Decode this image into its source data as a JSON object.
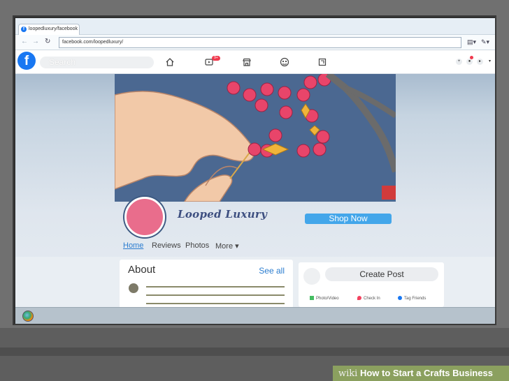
{
  "browser": {
    "tab_title": "loopedluxury/facebook",
    "address": "facebook.com/loopedluxury/"
  },
  "facebook": {
    "logo": "f",
    "search_placeholder": "Search",
    "notification_count": "9+",
    "page_name": "Looped Luxury",
    "shop_button": "Shop Now",
    "nav": {
      "home": "Home",
      "reviews": "Reviews",
      "photos": "Photos",
      "more": "More ▾"
    },
    "about": {
      "title": "About",
      "see_all": "See all"
    },
    "create_post": {
      "label": "Create Post",
      "photo_video": "Photo/Video",
      "check_in": "Check In",
      "tag_friends": "Tag Friends"
    }
  },
  "caption": {
    "brand": "wiki",
    "text": "How to Start a Crafts Business"
  },
  "colors": {
    "facebook_blue": "#1877f2",
    "shop_button": "#43a6ea",
    "avatar": "#e96d8c",
    "cover_bg": "#4b6891",
    "bead": "#e8456a"
  }
}
